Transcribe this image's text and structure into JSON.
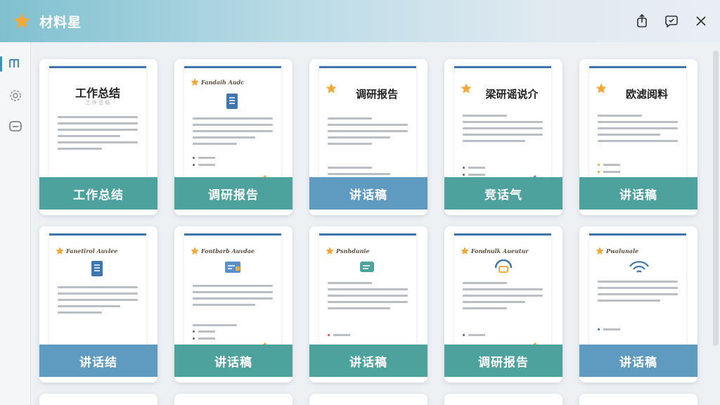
{
  "app": {
    "title": "材料星",
    "star_icon": "star-icon",
    "accent": "#f2a93b"
  },
  "titlebar_actions": [
    {
      "name": "share-button",
      "icon": "share-icon"
    },
    {
      "name": "feedback-button",
      "icon": "feedback-icon"
    },
    {
      "name": "close-button",
      "icon": "close-icon"
    }
  ],
  "sidebar": [
    {
      "name": "sidebar-item-templates",
      "icon": "grid-icon",
      "active": true
    },
    {
      "name": "sidebar-item-settings",
      "icon": "gear-icon",
      "active": false
    },
    {
      "name": "sidebar-item-messages",
      "icon": "chat-icon",
      "active": false
    }
  ],
  "cards": [
    {
      "label": "工作总结",
      "doc_title": "工作总结",
      "doc_sub": "工  作  总  结",
      "style": "title",
      "band": "teal"
    },
    {
      "label": "调研报告",
      "brand": "Fandaih Audc",
      "style": "brand",
      "band": "teal"
    },
    {
      "label": "讲话稿",
      "doc_title": "调研报告",
      "style": "star-title",
      "band": "blue"
    },
    {
      "label": "竞话气",
      "doc_title": "梁研谣说介",
      "style": "star-title",
      "band": "teal"
    },
    {
      "label": "讲话稿",
      "doc_title": "欧滤阅料",
      "style": "star-title",
      "band": "teal"
    },
    {
      "label": "讲话结",
      "brand": "Fanetirol Auvlee",
      "style": "brand",
      "band": "blue"
    },
    {
      "label": "讲话稿",
      "brand": "Fontbarb Auvdae",
      "style": "brand",
      "band": "teal"
    },
    {
      "label": "讲话稿",
      "brand": "Psnhdunie",
      "style": "brand",
      "band": "teal"
    },
    {
      "label": "调研报告",
      "brand": "Fondnulk Aueutur",
      "style": "brand",
      "band": "teal"
    },
    {
      "label": "讲话稿",
      "brand": "Pwalunale",
      "style": "brand",
      "band": "blue"
    }
  ]
}
